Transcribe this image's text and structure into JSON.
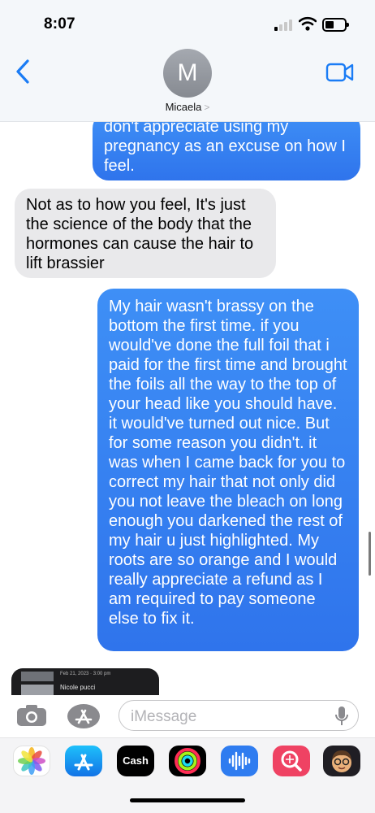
{
  "status": {
    "time": "8:07"
  },
  "header": {
    "contact_initial": "M",
    "contact_name": "Micaela",
    "contact_chevron": ">"
  },
  "messages": [
    {
      "direction": "sent",
      "text": "don't appreciate using my pregnancy as an excuse on how I feel."
    },
    {
      "direction": "received",
      "text": "Not as to how you feel, It's just the science of the body that the hormones can cause the hair to lift brassier"
    },
    {
      "direction": "sent",
      "text": "My hair wasn't brassy on the bottom the first time. if you would've done the full foil that i paid for the first time and brought the foils all the way to the top of your head like you should have. it would've turned out nice. But for some reason you didn't. it was when I came back for you to correct my hair that not only did you not leave the bleach on long enough you darkened the rest of my hair u just highlighted. My roots are so orange and I would really appreciate a refund as I am required to pay someone else to fix it."
    }
  ],
  "preview": {
    "date": "Feb 21, 2023 · 3:00 pm",
    "name": "Nicole pucci"
  },
  "input": {
    "placeholder": "iMessage"
  },
  "drawer": {
    "apps": [
      {
        "name": "photos-app-icon",
        "label": ""
      },
      {
        "name": "app-store-icon",
        "label": ""
      },
      {
        "name": "cash-app-icon",
        "label": "Cash"
      },
      {
        "name": "fitness-app-icon",
        "label": ""
      },
      {
        "name": "audio-message-icon",
        "label": ""
      },
      {
        "name": "image-search-icon",
        "label": ""
      },
      {
        "name": "memoji-icon",
        "label": ""
      }
    ]
  },
  "colors": {
    "sent_bubble": "#3281f0",
    "received_bubble": "#e9e9eb",
    "accent": "#1a7cf5"
  }
}
